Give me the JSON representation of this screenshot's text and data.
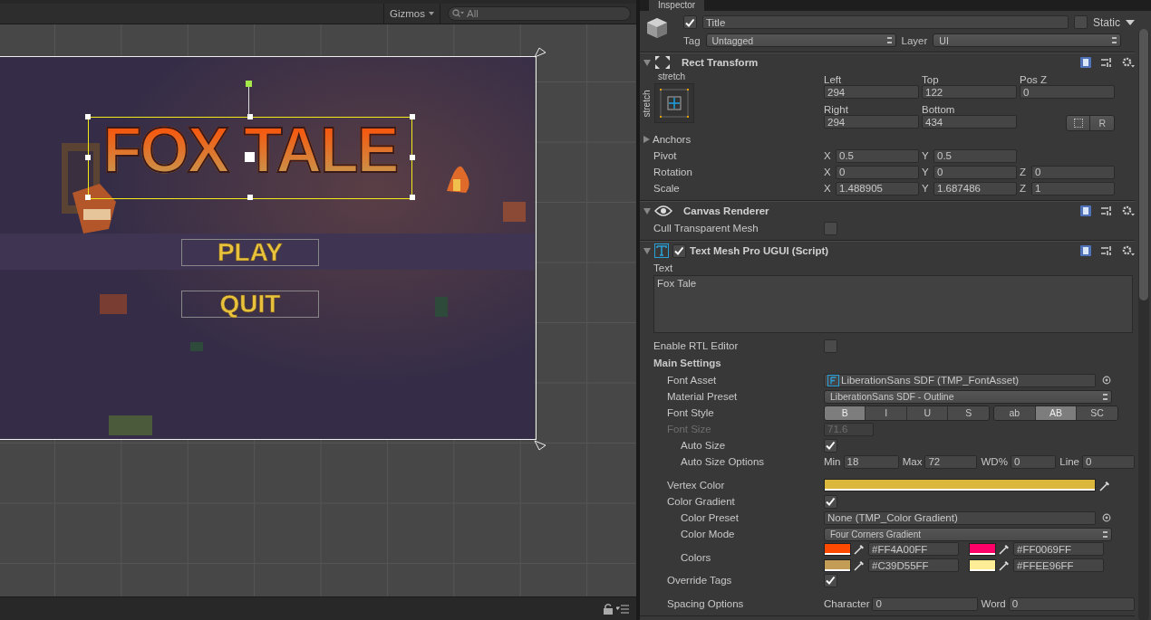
{
  "scene_toolbar": {
    "gizmos": "Gizmos",
    "search": {
      "placeholder": "All"
    }
  },
  "scene": {
    "title_text": "FOX TALE",
    "buttons": [
      {
        "label": "PLAY"
      },
      {
        "label": "QUIT"
      }
    ]
  },
  "inspector": {
    "tab": "Inspector",
    "object": {
      "active": true,
      "name": "Title",
      "static": false,
      "static_label": "Static",
      "tag_label": "Tag",
      "tag": "Untagged",
      "layer_label": "Layer",
      "layer": "UI"
    },
    "rect_transform": {
      "title": "Rect Transform",
      "anchor_top": "stretch",
      "anchor_side": "stretch",
      "fields": [
        {
          "label": "Left",
          "value": "294"
        },
        {
          "label": "Top",
          "value": "122"
        },
        {
          "label": "Pos Z",
          "value": "0"
        },
        {
          "label": "Right",
          "value": "294"
        },
        {
          "label": "Bottom",
          "value": "434"
        }
      ],
      "r_button": "R",
      "anchors": "Anchors",
      "vectors": [
        {
          "label": "Pivot",
          "axes": [
            {
              "axis": "X",
              "value": "0.5"
            },
            {
              "axis": "Y",
              "value": "0.5"
            }
          ]
        },
        {
          "label": "Rotation",
          "axes": [
            {
              "axis": "X",
              "value": "0"
            },
            {
              "axis": "Y",
              "value": "0"
            },
            {
              "axis": "Z",
              "value": "0"
            }
          ]
        },
        {
          "label": "Scale",
          "axes": [
            {
              "axis": "X",
              "value": "1.488905"
            },
            {
              "axis": "Y",
              "value": "1.687486"
            },
            {
              "axis": "Z",
              "value": "1"
            }
          ]
        }
      ]
    },
    "canvas_renderer": {
      "title": "Canvas Renderer",
      "cull_label": "Cull Transparent Mesh",
      "cull": false
    },
    "text_mesh_pro": {
      "title": "Text Mesh Pro UGUI (Script)",
      "enabled": true,
      "text_label": "Text",
      "text": "Fox Tale",
      "rtl_label": "Enable RTL Editor",
      "rtl": false,
      "section": "Main Settings",
      "rows": [
        {
          "kind": "font_asset",
          "label": "Font Asset",
          "value": "LiberationSans SDF (TMP_FontAsset)"
        },
        {
          "kind": "dropdown",
          "label": "Material Preset",
          "value": "LiberationSans SDF - Outline"
        },
        {
          "kind": "style_buttons",
          "label": "Font Style",
          "groups": [
            [
              {
                "label": "B",
                "selected": true
              },
              {
                "label": "I",
                "selected": false
              },
              {
                "label": "U",
                "selected": false
              },
              {
                "label": "S",
                "selected": false
              }
            ],
            [
              {
                "label": "ab",
                "selected": false
              },
              {
                "label": "AB",
                "selected": true
              },
              {
                "label": "SC",
                "selected": false
              }
            ]
          ]
        },
        {
          "kind": "number",
          "label": "Font Size",
          "value": "71.6",
          "disabled": true,
          "children": [
            {
              "kind": "checkbox",
              "label": "Auto Size",
              "checked": true
            },
            {
              "kind": "options",
              "label": "Auto Size Options",
              "fields": [
                {
                  "label": "Min",
                  "value": "18"
                },
                {
                  "label": "Max",
                  "value": "72"
                },
                {
                  "label": "WD%",
                  "value": "0"
                },
                {
                  "label": "Line",
                  "value": "0"
                }
              ]
            }
          ]
        },
        {
          "kind": "gap"
        },
        {
          "kind": "color",
          "label": "Vertex Color",
          "color": "#dbb83c"
        },
        {
          "kind": "checkbox",
          "label": "Color Gradient",
          "checked": true,
          "children": [
            {
              "kind": "object",
              "label": "Color Preset",
              "value": "None (TMP_Color Gradient)"
            },
            {
              "kind": "dropdown",
              "label": "Color Mode",
              "value": "Four Corners Gradient"
            },
            {
              "kind": "colors",
              "label": "Colors",
              "swatches": [
                {
                  "color": "#ff4a00",
                  "hex": "#FF4A00FF"
                },
                {
                  "color": "#ff0069",
                  "hex": "#FF0069FF"
                },
                {
                  "color": "#c39d55",
                  "hex": "#C39D55FF"
                },
                {
                  "color": "#ffee96",
                  "hex": "#FFEE96FF"
                }
              ]
            }
          ]
        },
        {
          "kind": "checkbox",
          "label": "Override Tags",
          "checked": true
        },
        {
          "kind": "gap"
        },
        {
          "kind": "options",
          "label": "Spacing Options",
          "fields": [
            {
              "label": "Character",
              "value": "0"
            },
            {
              "label": "Word",
              "value": "0"
            }
          ]
        }
      ]
    }
  }
}
